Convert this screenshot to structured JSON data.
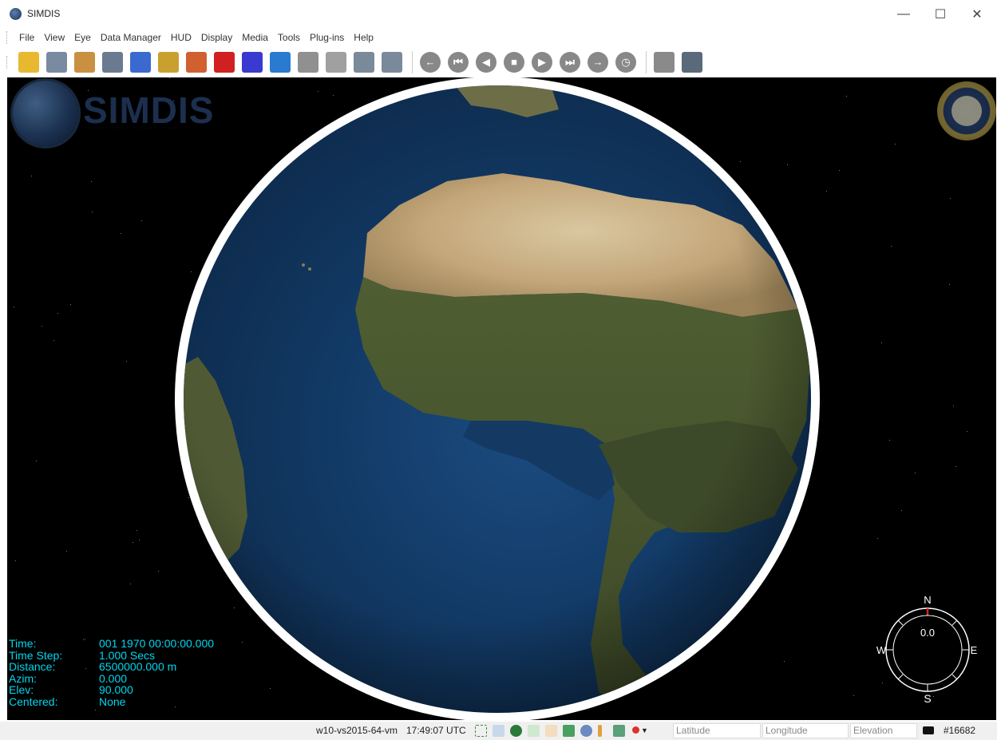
{
  "window": {
    "title": "SIMDIS",
    "controls": {
      "minimize": "—",
      "maximize": "☐",
      "close": "✕"
    }
  },
  "menu": [
    "File",
    "View",
    "Eye",
    "Data Manager",
    "HUD",
    "Display",
    "Media",
    "Tools",
    "Plug-ins",
    "Help"
  ],
  "toolbar": {
    "buttons": [
      {
        "name": "open-file-icon",
        "color": "#e8b830"
      },
      {
        "name": "save-icon",
        "color": "#7a8aa0"
      },
      {
        "name": "map-grid-icon",
        "color": "#c89040"
      },
      {
        "name": "table-icon",
        "color": "#6a7a90"
      },
      {
        "name": "database-icon",
        "color": "#3a6ad0"
      },
      {
        "name": "measure-icon",
        "color": "#c9a030"
      },
      {
        "name": "terrain-icon",
        "color": "#d06030"
      },
      {
        "name": "pushpin-icon",
        "color": "#d02020"
      },
      {
        "name": "grid-icon",
        "color": "#3a3ad0"
      },
      {
        "name": "globe-icon",
        "color": "#2a7ad0"
      },
      {
        "name": "trash-icon",
        "color": "#909090"
      },
      {
        "name": "text-icon",
        "color": "#a0a0a0"
      },
      {
        "name": "graph-settings-icon",
        "color": "#7a8a9a"
      },
      {
        "name": "fit-view-icon",
        "color": "#7a8a9a"
      }
    ],
    "playback": [
      {
        "name": "step-back-arrow-icon",
        "glyph": "←"
      },
      {
        "name": "skip-to-start-icon",
        "glyph": "⏮"
      },
      {
        "name": "play-reverse-icon",
        "glyph": "◀"
      },
      {
        "name": "stop-icon",
        "glyph": "■"
      },
      {
        "name": "play-icon",
        "glyph": "▶"
      },
      {
        "name": "skip-to-end-icon",
        "glyph": "⏭"
      },
      {
        "name": "step-forward-arrow-icon",
        "glyph": "→"
      },
      {
        "name": "clock-icon",
        "glyph": "◷"
      }
    ],
    "extras": [
      {
        "name": "stopwatch-settings-icon",
        "color": "#8a8a8a"
      },
      {
        "name": "camera-capture-icon",
        "color": "#5a6a7a"
      }
    ]
  },
  "viewport": {
    "logo_text": "SIMDIS",
    "compass": {
      "north": "N",
      "south": "S",
      "east": "E",
      "west": "W",
      "heading": "0.0"
    }
  },
  "hud": [
    {
      "label": "Time:",
      "value": "001 1970 00:00:00.000"
    },
    {
      "label": "Time Step:",
      "value": "1.000 Secs"
    },
    {
      "label": "Distance:",
      "value": "6500000.000 m"
    },
    {
      "label": "Azim:",
      "value": "0.000"
    },
    {
      "label": "Elev:",
      "value": "90.000"
    },
    {
      "label": "Centered:",
      "value": "None"
    }
  ],
  "status": {
    "host": "w10-vs2015-64-vm",
    "clock": "17:49:07 UTC",
    "latitude_placeholder": "Latitude",
    "longitude_placeholder": "Longitude",
    "elevation_placeholder": "Elevation",
    "id": "#16682"
  },
  "colors": {
    "hud_cyan": "#00d7ef",
    "viewport_bg": "#000000"
  }
}
